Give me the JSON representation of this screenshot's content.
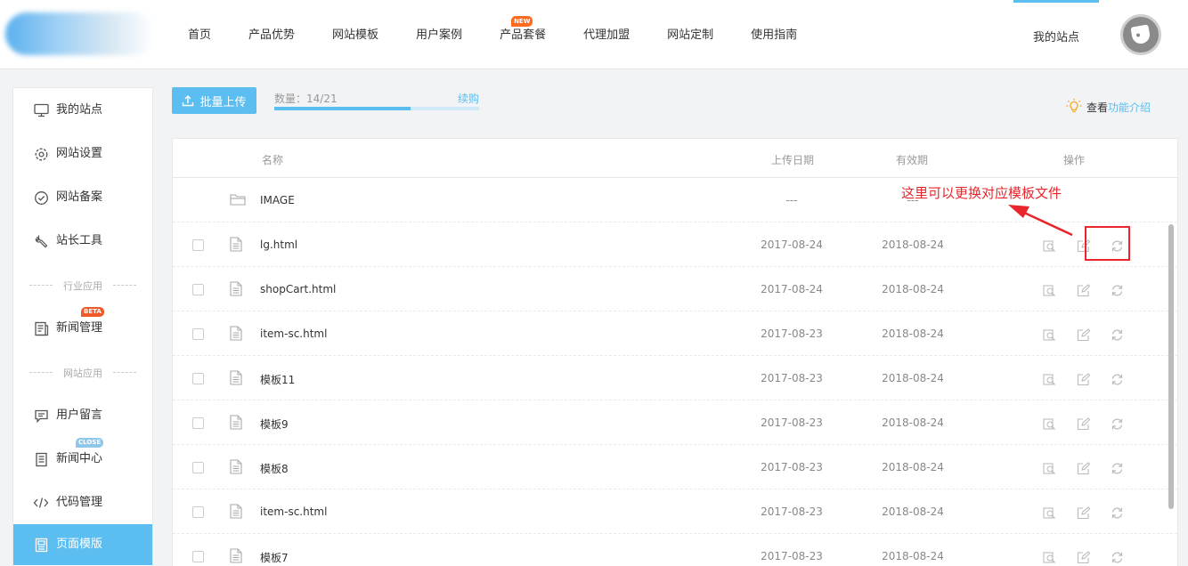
{
  "header": {
    "nav": [
      {
        "label": "首页"
      },
      {
        "label": "产品优势"
      },
      {
        "label": "网站模板"
      },
      {
        "label": "用户案例"
      },
      {
        "label": "产品套餐",
        "badge": "NEW"
      },
      {
        "label": "代理加盟"
      },
      {
        "label": "网站定制"
      },
      {
        "label": "使用指南"
      }
    ],
    "my_site": "我的站点"
  },
  "sidebar": {
    "items": [
      {
        "label": "我的站点",
        "icon": "monitor-icon"
      },
      {
        "label": "网站设置",
        "icon": "gear-icon"
      },
      {
        "label": "网站备案",
        "icon": "check-circle-icon"
      },
      {
        "label": "站长工具",
        "icon": "wrench-icon"
      }
    ],
    "group1": "行业应用",
    "group1_items": [
      {
        "label": "新闻管理",
        "badge": "BETA",
        "icon": "news-icon"
      }
    ],
    "group2": "网站应用",
    "group2_items": [
      {
        "label": "用户留言",
        "icon": "message-icon"
      },
      {
        "label": "新闻中心",
        "badge": "CLOSE",
        "icon": "document-icon"
      },
      {
        "label": "代码管理",
        "icon": "code-icon"
      },
      {
        "label": "页面模版",
        "icon": "page-template-icon",
        "active": true
      }
    ]
  },
  "toolbar": {
    "upload_label": "批量上传",
    "quota_label": "数量：14/21",
    "quota_used": 14,
    "quota_total": 21,
    "renew_label": "续购",
    "view_prefix": "查看",
    "view_link": "功能介绍"
  },
  "table": {
    "headers": {
      "name": "名称",
      "upload_date": "上传日期",
      "expiry": "有效期",
      "actions": "操作"
    },
    "folder": {
      "name": "IMAGE",
      "upload_date": "---",
      "expiry": "---"
    },
    "rows": [
      {
        "name": "lg.html",
        "upload_date": "2017-08-24",
        "expiry": "2018-08-24"
      },
      {
        "name": "shopCart.html",
        "upload_date": "2017-08-24",
        "expiry": "2018-08-24"
      },
      {
        "name": "item-sc.html",
        "upload_date": "2017-08-23",
        "expiry": "2018-08-24"
      },
      {
        "name": "模板11",
        "upload_date": "2017-08-23",
        "expiry": "2018-08-24"
      },
      {
        "name": "模板9",
        "upload_date": "2017-08-23",
        "expiry": "2018-08-24"
      },
      {
        "name": "模板8",
        "upload_date": "2017-08-23",
        "expiry": "2018-08-24"
      },
      {
        "name": "item-sc.html",
        "upload_date": "2017-08-23",
        "expiry": "2018-08-24"
      },
      {
        "name": "模板7",
        "upload_date": "2017-08-23",
        "expiry": "2018-08-24"
      }
    ]
  },
  "annotation": {
    "text": "这里可以更换对应模板文件",
    "color": "#e8262b"
  },
  "colors": {
    "accent": "#5bbdf0",
    "badge_new": "#ff6a1f",
    "badge_beta": "#f05a28",
    "badge_close": "#8fc7ea"
  }
}
